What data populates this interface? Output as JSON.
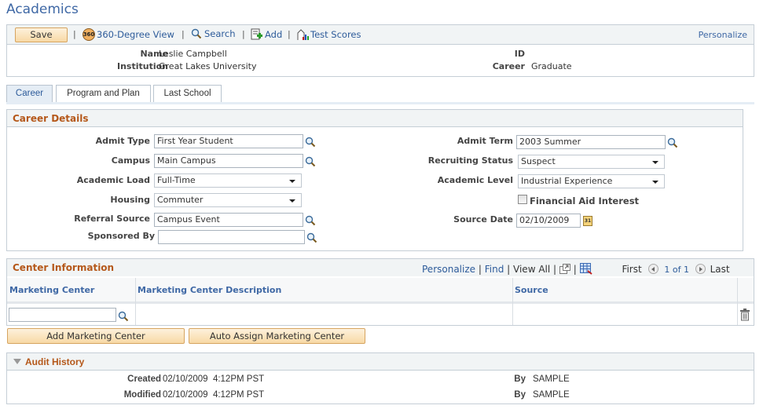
{
  "page": {
    "title": "Academics"
  },
  "toolbar": {
    "save_label": "Save",
    "view360_label": "360-Degree View",
    "view360_icon_text": "360",
    "search_label": "Search",
    "add_label": "Add",
    "test_scores_label": "Test Scores",
    "personalize_label": "Personalize",
    "separator": "|"
  },
  "header": {
    "name_label": "Name",
    "name_value": "Leslie Campbell",
    "institution_label": "Institution",
    "institution_value": "Great Lakes University",
    "id_label": "ID",
    "id_value": "",
    "career_label": "Career",
    "career_value": "Graduate"
  },
  "tabs": [
    {
      "label": "Career",
      "active": true
    },
    {
      "label": "Program and Plan",
      "active": false
    },
    {
      "label": "Last School",
      "active": false
    }
  ],
  "career_details": {
    "title": "Career Details",
    "admit_type": {
      "label": "Admit Type",
      "value": "First Year Student"
    },
    "campus": {
      "label": "Campus",
      "value": "Main Campus"
    },
    "academic_load": {
      "label": "Academic Load",
      "value": "Full-Time"
    },
    "housing": {
      "label": "Housing",
      "value": "Commuter"
    },
    "referral_source": {
      "label": "Referral Source",
      "value": "Campus Event"
    },
    "sponsored_by": {
      "label": "Sponsored By",
      "value": ""
    },
    "admit_term": {
      "label": "Admit Term",
      "value": "2003 Summer"
    },
    "recruiting_status": {
      "label": "Recruiting Status",
      "value": "Suspect"
    },
    "academic_level": {
      "label": "Academic Level",
      "value": "Industrial Experience"
    },
    "financial_aid_interest": {
      "label": "Financial Aid Interest",
      "checked": false
    },
    "source_date": {
      "label": "Source Date",
      "value": "02/10/2009",
      "calendar_icon_text": "31"
    }
  },
  "center_information": {
    "title": "Center Information",
    "nav": {
      "personalize": "Personalize",
      "find": "Find",
      "view_all": "View All",
      "first": "First",
      "pager": "1 of 1",
      "last": "Last",
      "separator": "|"
    },
    "columns": [
      "Marketing Center",
      "Marketing Center Description",
      "Source"
    ],
    "rows": [
      {
        "marketing_center": "",
        "description": "",
        "source": ""
      }
    ],
    "add_button": "Add Marketing Center",
    "auto_assign_button": "Auto Assign Marketing Center"
  },
  "audit_history": {
    "title": "Audit History",
    "created_label": "Created",
    "created_value": "02/10/2009  4:12PM PST",
    "created_by_label": "By",
    "created_by_value": "SAMPLE",
    "modified_label": "Modified",
    "modified_value": "02/10/2009  4:12PM PST",
    "modified_by_label": "By",
    "modified_by_value": "SAMPLE"
  },
  "colors": {
    "title_blue": "#3f68a5",
    "link_blue": "#2d5b9a",
    "section_orange": "#b5581a",
    "button_fill": "#f8d9a5",
    "panel_bg": "#f1f4f5"
  }
}
